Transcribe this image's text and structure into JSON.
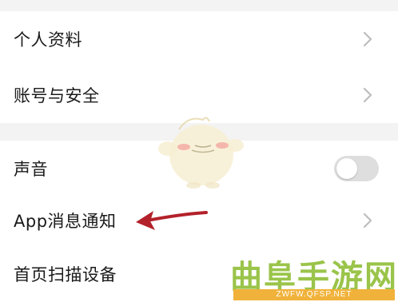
{
  "settings": {
    "group1": [
      {
        "label": "个人资料"
      },
      {
        "label": "账号与安全"
      }
    ],
    "group2": [
      {
        "label": "声音",
        "toggle_on": false
      },
      {
        "label": "App消息通知"
      },
      {
        "label": "首页扫描设备"
      }
    ]
  },
  "watermark": {
    "title": "曲阜手游网",
    "url": "ZWFW.QFSP.NET"
  },
  "colors": {
    "background": "#f3f3f3",
    "row_background": "#ffffff",
    "arrow": "#b3212a",
    "toggle_off": "#dedede",
    "watermark_green": "#9ac44a",
    "watermark_orange": "#f0b23a"
  }
}
